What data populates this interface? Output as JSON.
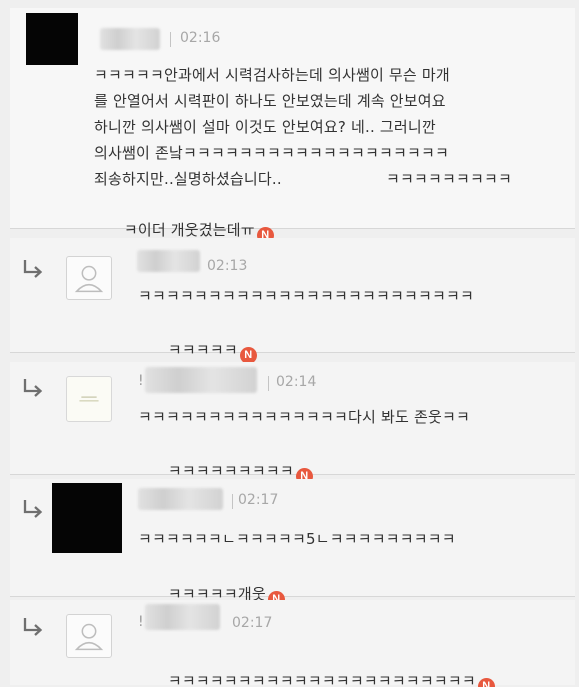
{
  "post": {
    "time": "02:16",
    "lines": [
      "ㅋㅋㅋㅋㅋ안과에서 시력검사하는데 의사쌤이 무슨 마개",
      "를 안열어서 시력판이 하나도 안보였는데 계속 안보여요",
      "하니깐 의사쌤이 설마 이것도 안보여요? 네.. 그러니깐",
      "의사쌤이 존낰ㅋㅋㅋㅋㅋㅋㅋㅋㅋㅋㅋㅋㅋㅋㅋㅋㅋㅋㅋ",
      "죄송하지만..실명하셨습니다..",
      "ㅋ이더 개웃겼는데ㅠ"
    ],
    "line5_tail": "ㅋㅋㅋㅋㅋㅋㅋㅋㅋ",
    "badge": "N"
  },
  "replies": [
    {
      "time": "02:13",
      "lines": [
        "ㅋㅋㅋㅋㅋㅋㅋㅋㅋㅋㅋㅋㅋㅋㅋㅋㅋㅋㅋㅋㅋㅋㅋㅋ",
        "ㅋㅋㅋㅋㅋ"
      ],
      "badge": "N"
    },
    {
      "time": "02:14",
      "name_prefix": "!",
      "lines": [
        "ㅋㅋㅋㅋㅋㅋㅋㅋㅋㅋㅋㅋㅋㅋㅋ다시 봐도 존웃ㅋㅋ",
        "ㅋㅋㅋㅋㅋㅋㅋㅋㅋ"
      ],
      "badge": "N"
    },
    {
      "time": "02:17",
      "lines": [
        "ㅋㅋㅋㅋㅋㅋㄴㅋㅋㅋㅋㅋ5ㄴㅋㅋㅋㅋㅋㅋㅋㅋㅋ",
        "ㅋㅋㅋㅋㅋ개웃"
      ],
      "badge": "N"
    },
    {
      "time": "02:17",
      "name_prefix": "!",
      "lines": [
        "ㅋㅋㅋㅋㅋㅋㅋㅋㅋㅋㅋㅋㅋㅋㅋㅋㅋㅋㅋㅋㅋㅋ"
      ],
      "badge": "N"
    }
  ],
  "icons": {
    "reply_arrow": "reply-arrow-icon",
    "default_avatar": "default-user-icon",
    "badge_color": "#e8583e"
  }
}
